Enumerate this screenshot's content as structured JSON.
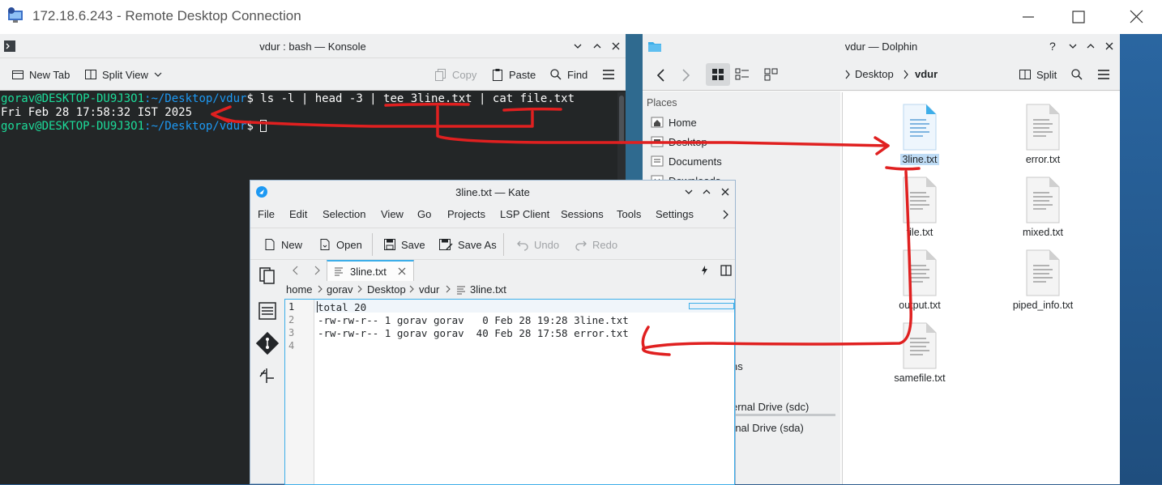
{
  "rdp": {
    "title": "172.18.6.243 - Remote Desktop Connection"
  },
  "konsole": {
    "title": "vdur : bash — Konsole",
    "toolbar": {
      "new_tab": "New Tab",
      "split_view": "Split View",
      "copy": "Copy",
      "paste": "Paste",
      "find": "Find"
    },
    "terminal": {
      "line1_user": "gorav@DESKTOP-DU9J3O1",
      "line1_path": ":~/Desktop/vdur",
      "line1_cmd": "$ ls -l | head -3 | tee 3line.txt | cat file.txt",
      "line2": "Fri Feb 28 17:58:32 IST 2025",
      "line3_user": "gorav@DESKTOP-DU9J3O1",
      "line3_path": ":~/Desktop/vdur",
      "line3_cmd": "$ "
    }
  },
  "dolphin": {
    "title": "vdur — Dolphin",
    "breadcrumb": [
      "Desktop",
      "vdur"
    ],
    "toolbar": {
      "split": "Split"
    },
    "places_header": "Places",
    "places": [
      {
        "label": "Home",
        "icon": "home-icon"
      },
      {
        "label": "Desktop",
        "icon": "desktop-icon"
      },
      {
        "label": "Documents",
        "icon": "documents-icon"
      },
      {
        "label": "Downloads",
        "icon": "downloads-icon"
      }
    ],
    "places_partial": [
      "ns",
      "ernal Drive (sdc)",
      "rnal Drive (sda)"
    ],
    "files": [
      {
        "name": "3line.txt",
        "selected": true
      },
      {
        "name": "error.txt"
      },
      {
        "name": "file.txt"
      },
      {
        "name": "mixed.txt"
      },
      {
        "name": "output.txt"
      },
      {
        "name": "piped_info.txt"
      },
      {
        "name": "samefile.txt"
      }
    ]
  },
  "kate": {
    "title": "3line.txt — Kate",
    "menu": [
      "File",
      "Edit",
      "Selection",
      "View",
      "Go",
      "Projects",
      "LSP Client",
      "Sessions",
      "Tools",
      "Settings"
    ],
    "toolbar": {
      "new": "New",
      "open": "Open",
      "save": "Save",
      "save_as": "Save As",
      "undo": "Undo",
      "redo": "Redo"
    },
    "tab_label": "3line.txt",
    "breadcrumb": [
      "home",
      "gorav",
      "Desktop",
      "vdur",
      "3line.txt"
    ],
    "lines": [
      {
        "num": "1",
        "text": "total 20"
      },
      {
        "num": "2",
        "text": "-rw-rw-r-- 1 gorav gorav   0 Feb 28 19:28 3line.txt"
      },
      {
        "num": "3",
        "text": "-rw-rw-r-- 1 gorav gorav  40 Feb 28 17:58 error.txt"
      },
      {
        "num": "4",
        "text": ""
      }
    ]
  },
  "annotation_color": "#e02020"
}
